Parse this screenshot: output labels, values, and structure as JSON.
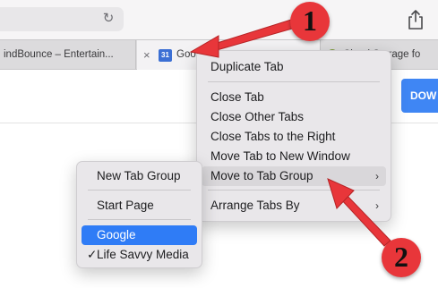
{
  "toolbar": {
    "reload_glyph": "↻"
  },
  "tabs": [
    {
      "label": "indBounce – Entertain..."
    },
    {
      "label": "Goo",
      "favicon_text": "31",
      "close_glyph": "×"
    },
    {
      "label": "Cloud Storage fo"
    }
  ],
  "page": {
    "download_button": "DOW"
  },
  "context_menu": {
    "items": [
      "Duplicate Tab",
      "Close Tab",
      "Close Other Tabs",
      "Close Tabs to the Right",
      "Move Tab to New Window",
      "Move to Tab Group",
      "Arrange Tabs By"
    ],
    "chevron": "›"
  },
  "submenu": {
    "items": [
      "New Tab Group",
      "Start Page",
      "Google",
      "Life Savvy Media"
    ],
    "check_glyph": "✓"
  },
  "annotations": {
    "badge1": "1",
    "badge2": "2",
    "arrow_color": "#e8363a"
  }
}
